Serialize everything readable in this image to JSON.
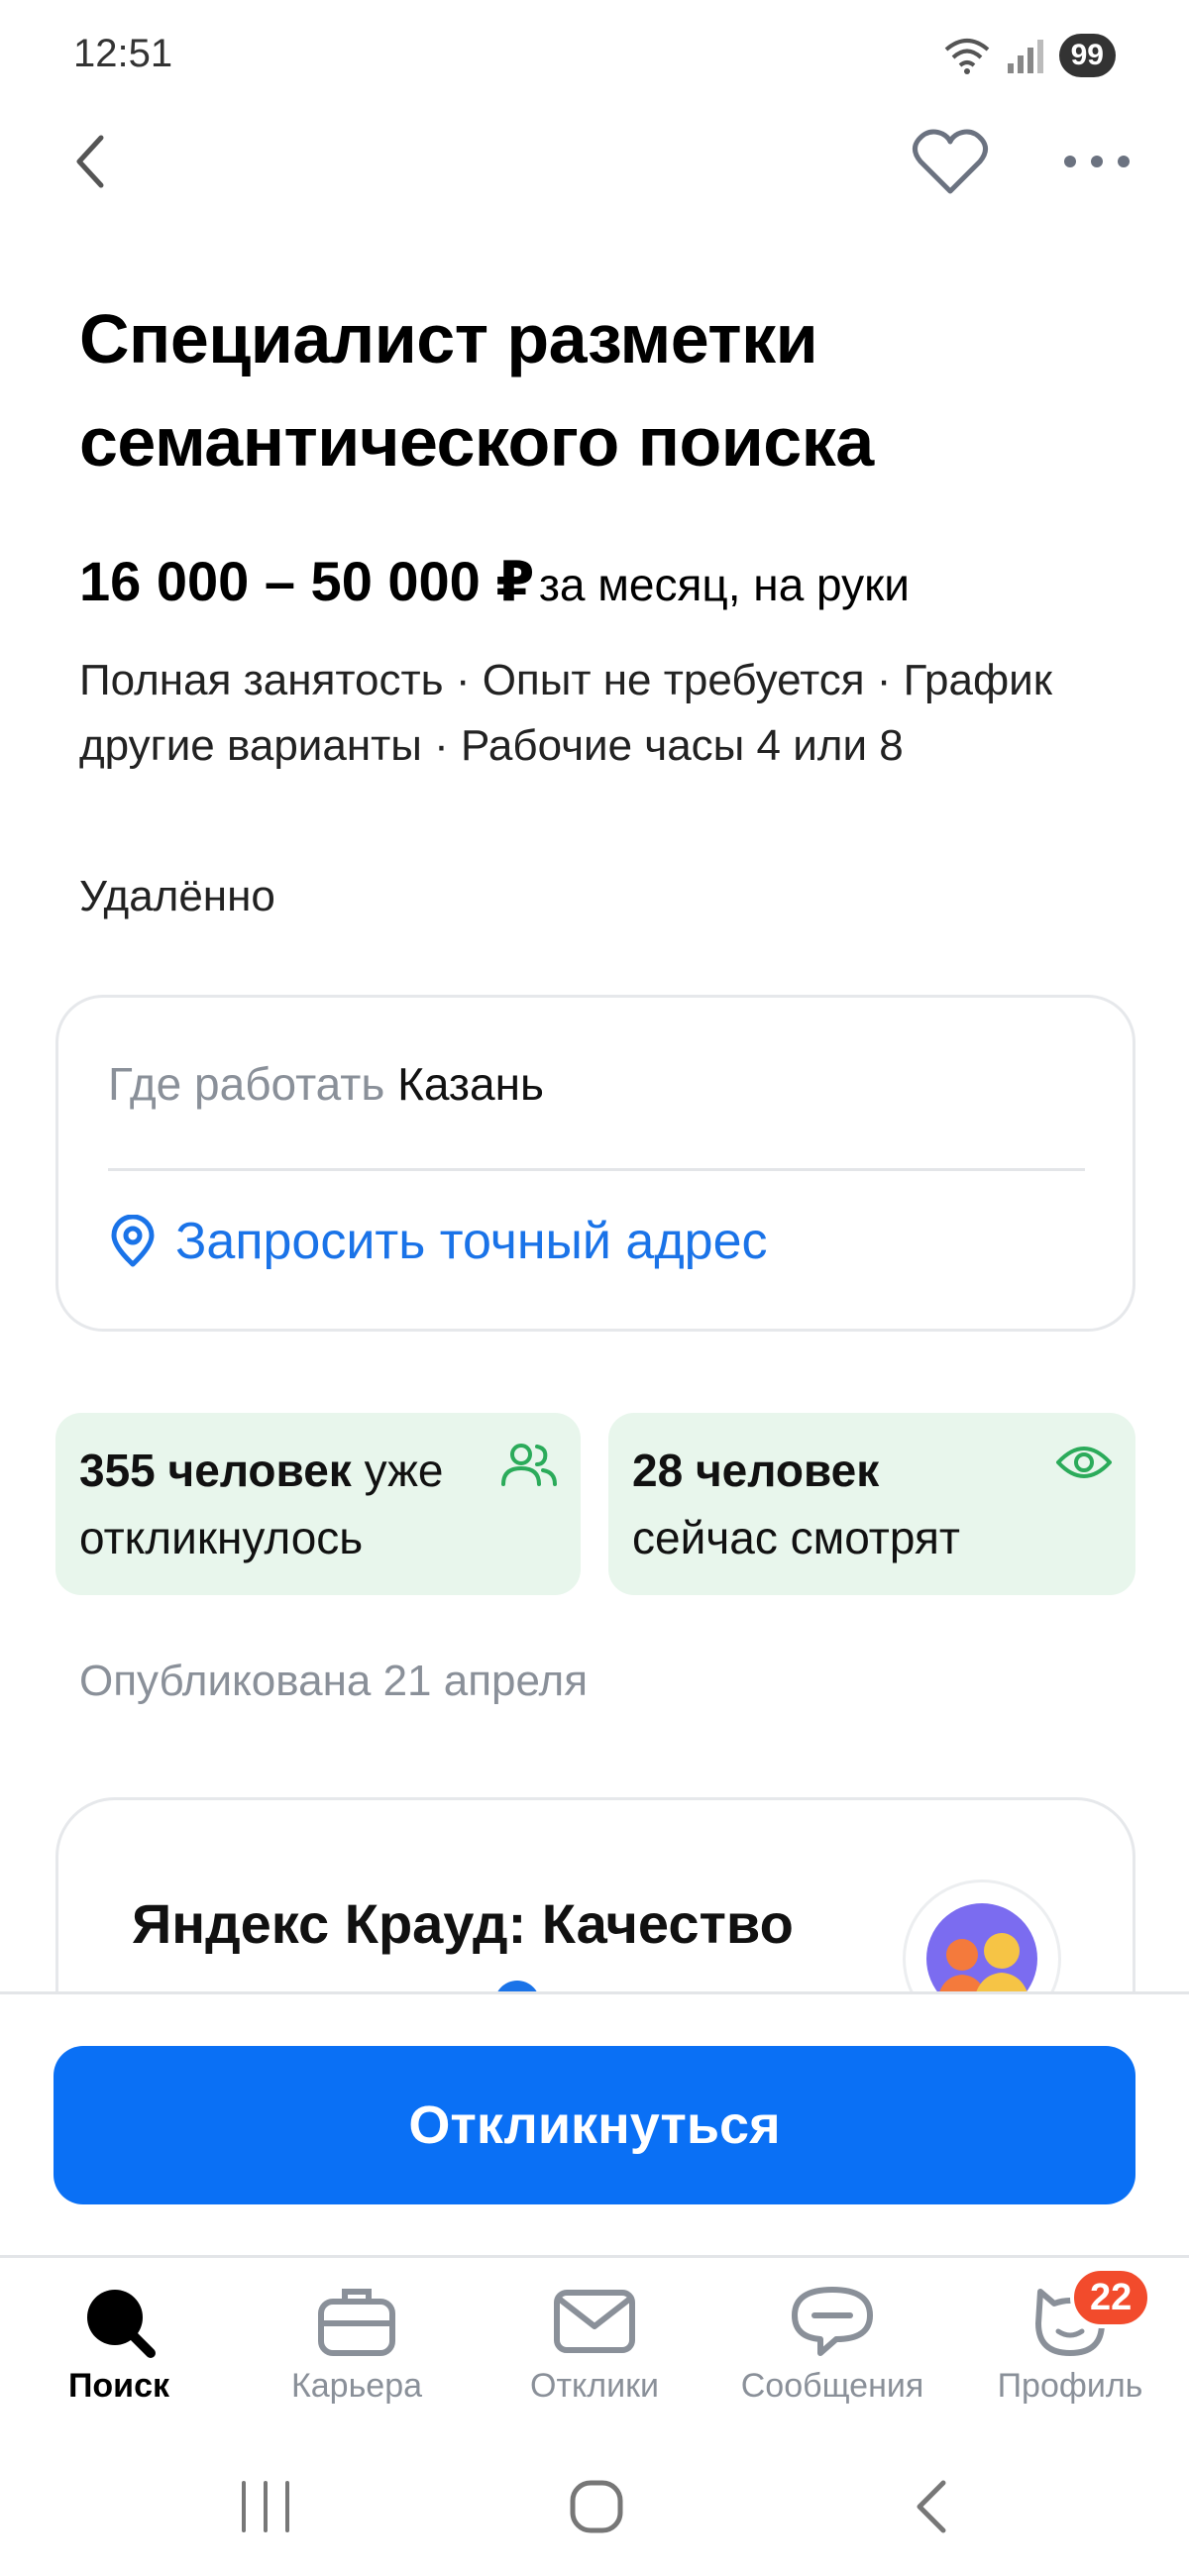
{
  "status_bar": {
    "time": "12:51",
    "battery": "99"
  },
  "vacancy": {
    "title": "Специалист разметки семантического поиска",
    "salary": "16 000 – 50 000 ₽",
    "salary_note": "за месяц, на руки",
    "conditions": "Полная занятость · Опыт не требуется · График другие варианты · Рабочие часы 4 или 8",
    "work_format": "Удалённо"
  },
  "location": {
    "label": "Где работать",
    "city": "Казань",
    "request_address": "Запросить точный адрес"
  },
  "stats": {
    "applied_count": "355 человек",
    "applied_rest": "уже откликнулось",
    "viewing_count": "28 человек",
    "viewing_rest": "сейчас смотрят"
  },
  "published": "Опубликована 21 апреля",
  "company": {
    "name": "Яндекс Крауд: Качество"
  },
  "apply_button": "Откликнуться",
  "tabs": [
    {
      "label": "Поиск",
      "icon": "search-icon"
    },
    {
      "label": "Карьера",
      "icon": "briefcase-icon"
    },
    {
      "label": "Отклики",
      "icon": "envelope-icon"
    },
    {
      "label": "Сообщения",
      "icon": "chat-icon"
    },
    {
      "label": "Профиль",
      "icon": "profile-icon"
    }
  ],
  "profile_badge": "22",
  "colors": {
    "accent": "#0a70f5",
    "link": "#1a73e8",
    "stat_bg": "#e8f6ec",
    "stat_icon": "#2bab5a",
    "badge": "#f24b2c"
  }
}
